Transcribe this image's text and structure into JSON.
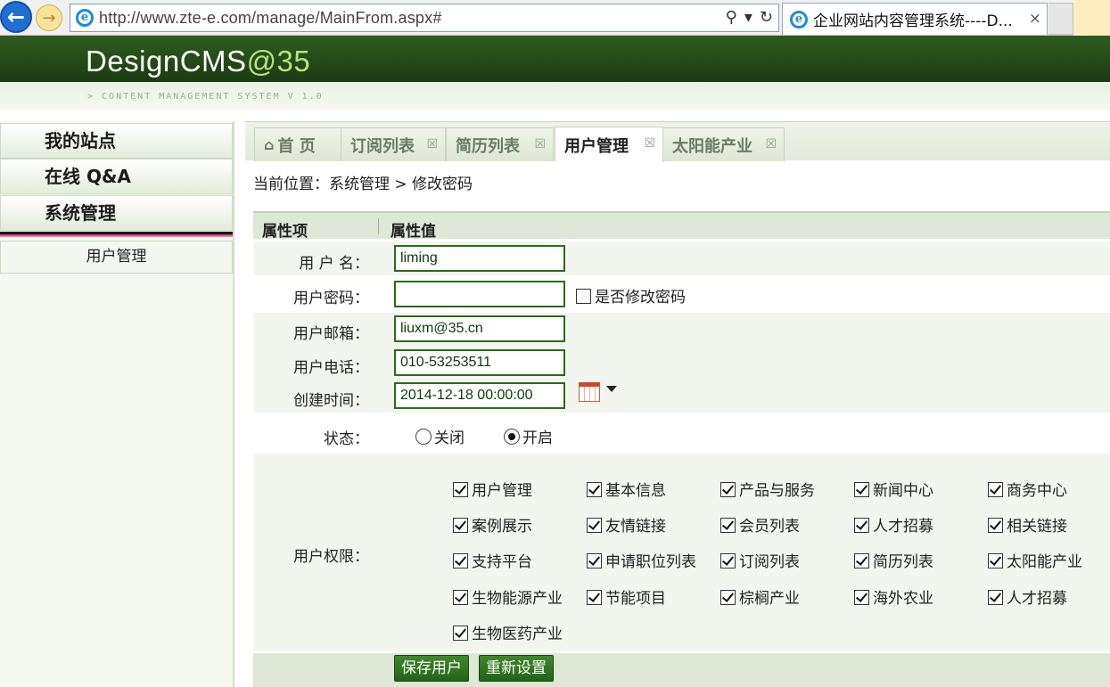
{
  "browser": {
    "url": "http://www.zte-e.com/manage/MainFrom.aspx#",
    "tab_title": "企业网站内容管理系统----D...",
    "tab_close": "×",
    "search_icon": "⚲",
    "dropdown_icon": "▾",
    "refresh_icon": "↻"
  },
  "header": {
    "logo_text": "DesignCMS",
    "logo_at": "@35",
    "tagline": "> CONTENT MANAGEMENT SYSTEM V 1.0"
  },
  "sidebar": {
    "items": [
      {
        "label": "我的站点"
      },
      {
        "label": "在线 Q&A"
      },
      {
        "label": "系统管理"
      }
    ],
    "subitem": "用户管理"
  },
  "tabs": [
    {
      "label": "首 页",
      "icon": "home-icon"
    },
    {
      "label": "订阅列表",
      "close": "☒"
    },
    {
      "label": "简历列表",
      "close": "☒"
    },
    {
      "label": "用户管理",
      "close": "☒",
      "active": true
    },
    {
      "label": "太阳能产业",
      "close": "☒"
    }
  ],
  "breadcrumb": "当前位置：系统管理 > 修改密码",
  "form": {
    "head_key": "属性项",
    "head_value": "属性值",
    "username_label": "用 户 名：",
    "username_value": "liming",
    "password_label": "用户密码：",
    "password_value": "",
    "change_pw_label": "是否修改密码",
    "email_label": "用户邮箱：",
    "email_value": "liuxm@35.cn",
    "phone_label": "用户电话：",
    "phone_value": "010-53253511",
    "created_label": "创建时间：",
    "created_value": "2014-12-18 00:00:00",
    "status_label": "状态：",
    "status_off": "关闭",
    "status_on": "开启",
    "perm_label": "用户权限：",
    "permissions": [
      "用户管理",
      "基本信息",
      "产品与服务",
      "新闻中心",
      "商务中心",
      "案例展示",
      "友情链接",
      "会员列表",
      "人才招募",
      "相关链接",
      "支持平台",
      "申请职位列表",
      "订阅列表",
      "简历列表",
      "太阳能产业",
      "生物能源产业",
      "节能项目",
      "棕榈产业",
      "海外农业",
      "人才招募",
      "生物医药产业"
    ]
  },
  "actions": {
    "save": "保存用户",
    "reset": "重新设置"
  }
}
